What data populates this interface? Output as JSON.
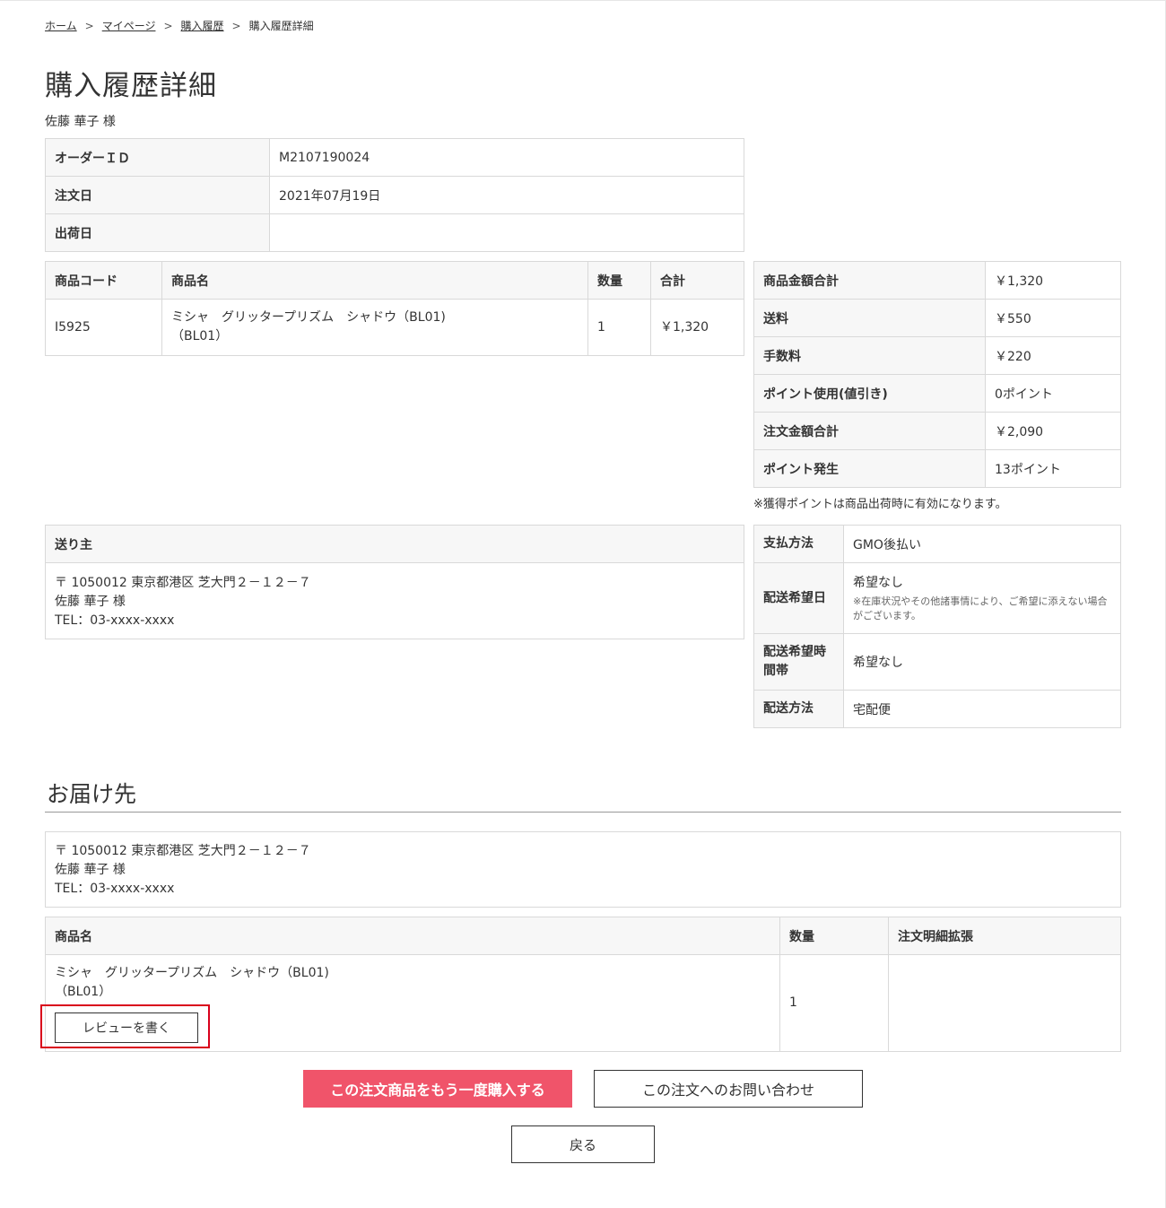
{
  "breadcrumb": {
    "items": [
      {
        "label": "ホーム"
      },
      {
        "label": "マイページ"
      },
      {
        "label": "購入履歴"
      }
    ],
    "current": "購入履歴詳細",
    "separator": ">"
  },
  "page_title": "購入履歴詳細",
  "customer_name": "佐藤 華子 様",
  "order_info": {
    "order_id_label": "オーダーＩＤ",
    "order_id": "M2107190024",
    "order_date_label": "注文日",
    "order_date": "2021年07月19日",
    "ship_date_label": "出荷日",
    "ship_date": ""
  },
  "items_table": {
    "headers": [
      "商品コード",
      "商品名",
      "数量",
      "合計"
    ],
    "rows": [
      {
        "code": "I5925",
        "name_line1": "ミシャ　グリッタープリズム　シャドウ（BL01)",
        "name_line2": "（BL01）",
        "qty": "1",
        "total": "￥1,320"
      }
    ]
  },
  "summary": {
    "rows": [
      {
        "label": "商品金額合計",
        "value": "￥1,320"
      },
      {
        "label": "送料",
        "value": "￥550"
      },
      {
        "label": "手数料",
        "value": "￥220"
      },
      {
        "label": "ポイント使用(値引き)",
        "value": "0ポイント"
      },
      {
        "label": "注文金額合計",
        "value": "￥2,090"
      },
      {
        "label": "ポイント発生",
        "value": "13ポイント"
      }
    ],
    "note": "※獲得ポイントは商品出荷時に有効になります。"
  },
  "sender": {
    "header": "送り主",
    "address": "〒 1050012 東京都港区 芝大門２－１２－７",
    "name": "佐藤 華子 様",
    "tel": "TEL：03-xxxx-xxxx"
  },
  "payment": {
    "method_label": "支払方法",
    "method": "GMO後払い",
    "date_label": "配送希望日",
    "date": "希望なし",
    "date_note": "※在庫状況やその他諸事情により、ご希望に添えない場合がございます。",
    "time_label": "配送希望時間帯",
    "time": "希望なし",
    "delivery_label": "配送方法",
    "delivery": "宅配便"
  },
  "destination": {
    "title": "お届け先",
    "address": "〒 1050012 東京都港区 芝大門２－１２－７",
    "name": "佐藤 華子 様",
    "tel": "TEL：03-xxxx-xxxx",
    "table_headers": [
      "商品名",
      "数量",
      "注文明細拡張"
    ],
    "item_name_line1": "ミシャ　グリッタープリズム　シャドウ（BL01)",
    "item_name_line2": "（BL01）",
    "item_qty": "1",
    "item_ext": "",
    "review_button": "レビューを書く"
  },
  "actions": {
    "rebuy": "この注文商品をもう一度購入する",
    "inquiry": "この注文へのお問い合わせ",
    "back": "戻る"
  },
  "colors": {
    "primary_button": "#f0546a",
    "highlight_box": "#d9001b"
  }
}
